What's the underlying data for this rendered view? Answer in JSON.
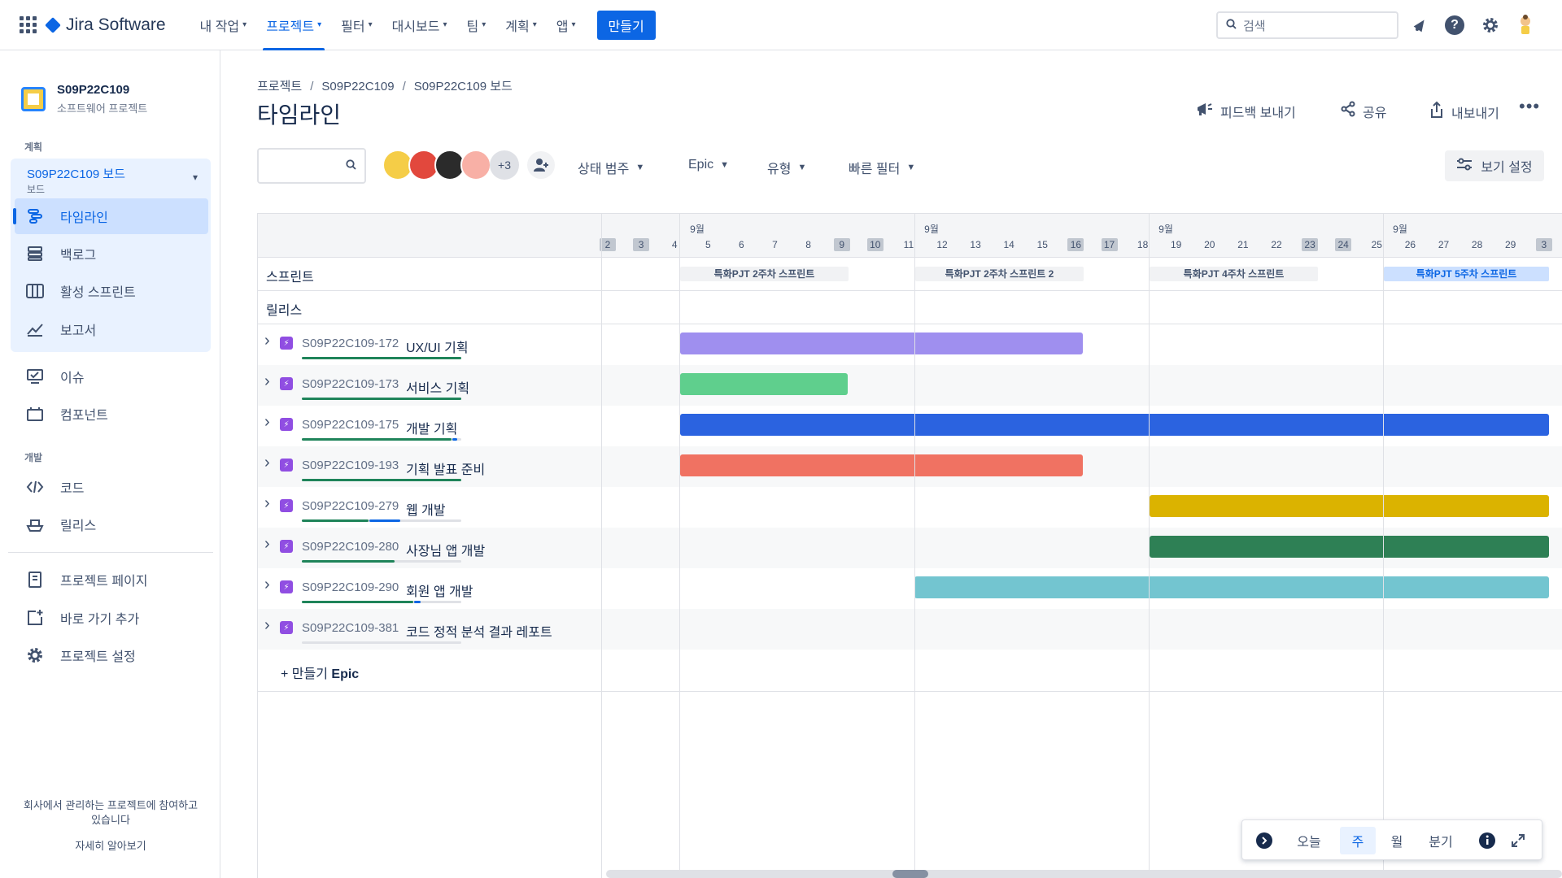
{
  "topnav": {
    "logo": "Jira Software",
    "items": [
      {
        "label": "내 작업"
      },
      {
        "label": "프로젝트",
        "active": true
      },
      {
        "label": "필터"
      },
      {
        "label": "대시보드"
      },
      {
        "label": "팀"
      },
      {
        "label": "계획"
      },
      {
        "label": "앱"
      }
    ],
    "create_label": "만들기",
    "search_placeholder": "검색",
    "icons": [
      "notification-icon",
      "help-icon",
      "settings-icon",
      "profile-avatar"
    ]
  },
  "sidebar": {
    "project_name": "S09P22C109",
    "project_type": "소프트웨어 프로젝트",
    "section_plan": "계획",
    "board_title": "S09P22C109 보드",
    "board_sub": "보드",
    "plan_items": [
      {
        "label": "타임라인",
        "icon": "timeline-icon",
        "active": true
      },
      {
        "label": "백로그",
        "icon": "backlog-icon"
      },
      {
        "label": "활성 스프린트",
        "icon": "board-icon"
      },
      {
        "label": "보고서",
        "icon": "reports-icon"
      }
    ],
    "other_items": [
      {
        "label": "이슈",
        "icon": "issues-icon"
      },
      {
        "label": "컴포넌트",
        "icon": "components-icon"
      }
    ],
    "section_dev": "개발",
    "dev_items": [
      {
        "label": "코드",
        "icon": "code-icon"
      },
      {
        "label": "릴리스",
        "icon": "release-icon"
      }
    ],
    "bottom_items": [
      {
        "label": "프로젝트 페이지",
        "icon": "pages-icon"
      },
      {
        "label": "바로 가기 추가",
        "icon": "add-shortcut-icon"
      },
      {
        "label": "프로젝트 설정",
        "icon": "gear-icon"
      }
    ],
    "footer_text_1": "회사에서 관리하는 프로젝트에 참여하고",
    "footer_text_2": "있습니다",
    "footer_link": "자세히 알아보기"
  },
  "main": {
    "breadcrumb": [
      "프로젝트",
      "S09P22C109",
      "S09P22C109 보드"
    ],
    "title": "타임라인",
    "actions": {
      "feedback": "피드백 보내기",
      "share": "공유",
      "export": "내보내기"
    },
    "avatars_more": "+3",
    "filters": {
      "status": "상태 범주",
      "epic": "Epic",
      "type": "유형",
      "quick": "빠른 필터"
    },
    "view_settings": "보기 설정"
  },
  "timeline": {
    "months": [
      "9월",
      "9월",
      "9월",
      "9월"
    ],
    "days": [
      "2",
      "3",
      "4",
      "5",
      "6",
      "7",
      "8",
      "9",
      "10",
      "11",
      "12",
      "13",
      "14",
      "15",
      "16",
      "17",
      "18",
      "19",
      "20",
      "21",
      "22",
      "23",
      "24",
      "25",
      "26",
      "27",
      "28",
      "29",
      "3"
    ],
    "weekend_days": [
      "2",
      "3",
      "9",
      "10",
      "16",
      "17",
      "23",
      "24"
    ],
    "sprint_row_label": "스프린트",
    "release_row_label": "릴리스",
    "sprints": [
      {
        "label": "특화PJT 2주차 스프린트"
      },
      {
        "label": "특화PJT 2주차 스프린트 2"
      },
      {
        "label": "특화PJT 4주차 스프린트"
      },
      {
        "label": "특화PJT 5주차 스프린트",
        "current": true
      }
    ],
    "epics": [
      {
        "key": "S09P22C109-172",
        "name": "UX/UI 기획",
        "color": "#9f8fef",
        "done": 1.0,
        "inprogress": 0.0
      },
      {
        "key": "S09P22C109-173",
        "name": "서비스 기획",
        "color": "#5fcf8d",
        "done": 1.0,
        "inprogress": 0.0
      },
      {
        "key": "S09P22C109-175",
        "name": "개발 기획",
        "color": "#2b63e0",
        "done": 0.94,
        "inprogress": 0.03
      },
      {
        "key": "S09P22C109-193",
        "name": "기획 발표 준비",
        "color": "#f07262",
        "done": 1.0,
        "inprogress": 0.0
      },
      {
        "key": "S09P22C109-279",
        "name": "웹 개발",
        "color": "#dbb300",
        "done": 0.42,
        "inprogress": 0.19
      },
      {
        "key": "S09P22C109-280",
        "name": "사장님 앱 개발",
        "color": "#2e8055",
        "done": 0.58,
        "inprogress": 0.0
      },
      {
        "key": "S09P22C109-290",
        "name": "회원 앱 개발",
        "color": "#73c5d0",
        "done": 0.7,
        "inprogress": 0.04
      },
      {
        "key": "S09P22C109-381",
        "name": "코드 정적 분석 결과 레포트",
        "color": "",
        "done": 0.0,
        "inprogress": 0.0
      }
    ],
    "create_epic": "+ 만들기",
    "create_epic_bold": "Epic"
  },
  "zoom": {
    "today": "오늘",
    "week": "주",
    "month": "월",
    "quarter": "분기",
    "selected": "week"
  }
}
